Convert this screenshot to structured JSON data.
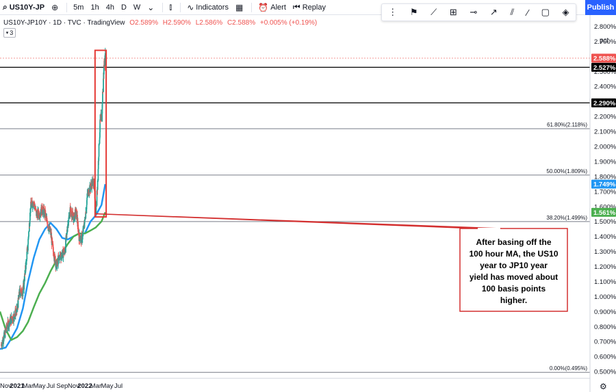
{
  "toolbar": {
    "symbol": "US10Y-JP",
    "intervals": [
      "5m",
      "1h",
      "4h",
      "D",
      "W"
    ],
    "indicators_label": "Indicators",
    "alert_label": "Alert",
    "replay_label": "Replay",
    "publish_label": "Publish"
  },
  "legend": {
    "title": "US10Y-JP10Y · 1D · TVC · TradingView",
    "open": "O2.589%",
    "high": "H2.590%",
    "low": "L2.586%",
    "close": "C2.588%",
    "change": "+0.005% (+0.19%)",
    "study_count": "3"
  },
  "colors": {
    "up": "#26a69a",
    "down": "#ef5350",
    "ma_fast": "#2196f3",
    "ma_slow": "#4caf50",
    "highlight_box": "#e53935",
    "annotation_border": "#d32f2f"
  },
  "chart_data": {
    "type": "candlestick",
    "y_unit": "pct",
    "ylim": [
      0.455,
      2.875
    ],
    "x_ticks": [
      "Nov",
      "2021",
      "Mar",
      "May",
      "Jul",
      "Sep",
      "Nov",
      "2022",
      "Mar",
      "May",
      "Jul"
    ],
    "y_ticks": [
      "2.800%",
      "2.700%",
      "2.600%",
      "2.500%",
      "2.400%",
      "2.300%",
      "2.200%",
      "2.100%",
      "2.000%",
      "1.900%",
      "1.800%",
      "1.700%",
      "1.600%",
      "1.500%",
      "1.400%",
      "1.300%",
      "1.200%",
      "1.100%",
      "1.000%",
      "0.900%",
      "0.800%",
      "0.700%",
      "0.600%",
      "0.500%"
    ],
    "close_path": [
      {
        "date": "2020-10-08",
        "value": 0.68
      },
      {
        "date": "2020-10-25",
        "value": 0.74
      },
      {
        "date": "2020-11-08",
        "value": 0.8
      },
      {
        "date": "2020-11-25",
        "value": 0.84
      },
      {
        "date": "2020-12-10",
        "value": 0.86
      },
      {
        "date": "2021-01-01",
        "value": 0.91
      },
      {
        "date": "2021-01-15",
        "value": 1.03
      },
      {
        "date": "2021-02-01",
        "value": 1.03
      },
      {
        "date": "2021-02-15",
        "value": 1.18
      },
      {
        "date": "2021-03-01",
        "value": 1.36
      },
      {
        "date": "2021-03-15",
        "value": 1.6
      },
      {
        "date": "2021-04-01",
        "value": 1.63
      },
      {
        "date": "2021-04-15",
        "value": 1.55
      },
      {
        "date": "2021-05-01",
        "value": 1.55
      },
      {
        "date": "2021-05-15",
        "value": 1.58
      },
      {
        "date": "2021-06-01",
        "value": 1.55
      },
      {
        "date": "2021-06-15",
        "value": 1.48
      },
      {
        "date": "2021-07-01",
        "value": 1.42
      },
      {
        "date": "2021-07-15",
        "value": 1.3
      },
      {
        "date": "2021-08-01",
        "value": 1.2
      },
      {
        "date": "2021-08-15",
        "value": 1.26
      },
      {
        "date": "2021-09-01",
        "value": 1.28
      },
      {
        "date": "2021-09-15",
        "value": 1.3
      },
      {
        "date": "2021-10-01",
        "value": 1.48
      },
      {
        "date": "2021-10-15",
        "value": 1.58
      },
      {
        "date": "2021-11-01",
        "value": 1.52
      },
      {
        "date": "2021-11-15",
        "value": 1.57
      },
      {
        "date": "2021-12-01",
        "value": 1.4
      },
      {
        "date": "2021-12-15",
        "value": 1.38
      },
      {
        "date": "2022-01-01",
        "value": 1.5
      },
      {
        "date": "2022-01-15",
        "value": 1.68
      },
      {
        "date": "2022-02-01",
        "value": 1.73
      },
      {
        "date": "2022-02-15",
        "value": 1.77
      },
      {
        "date": "2022-02-25",
        "value": 1.66
      },
      {
        "date": "2022-03-01",
        "value": 1.56
      },
      {
        "date": "2022-03-10",
        "value": 1.74
      },
      {
        "date": "2022-03-20",
        "value": 2.05
      },
      {
        "date": "2022-03-27",
        "value": 2.2
      },
      {
        "date": "2022-04-01",
        "value": 2.14
      },
      {
        "date": "2022-04-08",
        "value": 2.38
      },
      {
        "date": "2022-04-15",
        "value": 2.55
      },
      {
        "date": "2022-04-21",
        "value": 2.588
      }
    ],
    "series": [
      {
        "values": [
          {
            "date": "2020-10-01",
            "value": 0.65
          },
          {
            "date": "2020-11-01",
            "value": 0.66
          },
          {
            "date": "2020-12-01",
            "value": 0.72
          },
          {
            "date": "2021-01-01",
            "value": 0.79
          },
          {
            "date": "2021-02-01",
            "value": 0.92
          },
          {
            "date": "2021-03-01",
            "value": 1.1
          },
          {
            "date": "2021-04-01",
            "value": 1.26
          },
          {
            "date": "2021-05-01",
            "value": 1.38
          },
          {
            "date": "2021-06-01",
            "value": 1.45
          },
          {
            "date": "2021-07-01",
            "value": 1.49
          },
          {
            "date": "2021-08-01",
            "value": 1.45
          },
          {
            "date": "2021-09-01",
            "value": 1.39
          },
          {
            "date": "2021-10-01",
            "value": 1.38
          },
          {
            "date": "2021-11-01",
            "value": 1.4
          },
          {
            "date": "2021-12-01",
            "value": 1.42
          },
          {
            "date": "2022-01-01",
            "value": 1.42
          },
          {
            "date": "2022-02-01",
            "value": 1.5
          },
          {
            "date": "2022-03-01",
            "value": 1.54
          },
          {
            "date": "2022-04-01",
            "value": 1.61
          },
          {
            "date": "2022-04-21",
            "value": 1.749
          }
        ]
      },
      {
        "values": [
          {
            "date": "2020-10-01",
            "value": 0.9
          },
          {
            "date": "2020-11-01",
            "value": 0.78
          },
          {
            "date": "2020-12-01",
            "value": 0.71
          },
          {
            "date": "2021-01-01",
            "value": 0.73
          },
          {
            "date": "2021-02-01",
            "value": 0.77
          },
          {
            "date": "2021-03-01",
            "value": 0.83
          },
          {
            "date": "2021-04-01",
            "value": 0.93
          },
          {
            "date": "2021-05-01",
            "value": 1.02
          },
          {
            "date": "2021-06-01",
            "value": 1.09
          },
          {
            "date": "2021-07-01",
            "value": 1.17
          },
          {
            "date": "2021-08-01",
            "value": 1.24
          },
          {
            "date": "2021-09-01",
            "value": 1.29
          },
          {
            "date": "2021-10-01",
            "value": 1.35
          },
          {
            "date": "2021-11-01",
            "value": 1.4
          },
          {
            "date": "2021-12-01",
            "value": 1.42
          },
          {
            "date": "2022-01-01",
            "value": 1.42
          },
          {
            "date": "2022-02-01",
            "value": 1.44
          },
          {
            "date": "2022-03-01",
            "value": 1.46
          },
          {
            "date": "2022-04-01",
            "value": 1.5
          },
          {
            "date": "2022-04-21",
            "value": 1.561
          }
        ]
      }
    ],
    "horizontal_lines": [
      {
        "value": 2.527,
        "label": "2.527%"
      },
      {
        "value": 2.29,
        "label": "2.290%"
      }
    ],
    "fib_levels": [
      {
        "value": 2.118,
        "label": "61.80%(2.118%)"
      },
      {
        "value": 1.809,
        "label": "50.00%(1.809%)"
      },
      {
        "value": 1.499,
        "label": "38.20%(1.499%)"
      },
      {
        "value": 0.495,
        "label": "0.00%(0.495%)"
      }
    ],
    "price_labels": [
      {
        "value": 2.588,
        "label": "2.588%"
      },
      {
        "value": 2.527,
        "label": "2.527%"
      },
      {
        "value": 2.29,
        "label": "2.290%"
      },
      {
        "value": 1.749,
        "label": "1.749%"
      },
      {
        "value": 1.561,
        "label": "1.561%"
      }
    ],
    "highlight_box": {
      "from": "2022-02-25",
      "to": "2022-04-26",
      "low": 1.53,
      "high": 2.64
    },
    "annotation": "After basing off the 100 hour MA, the US10 year to JP10 year yield has moved about 100 basis points higher."
  }
}
